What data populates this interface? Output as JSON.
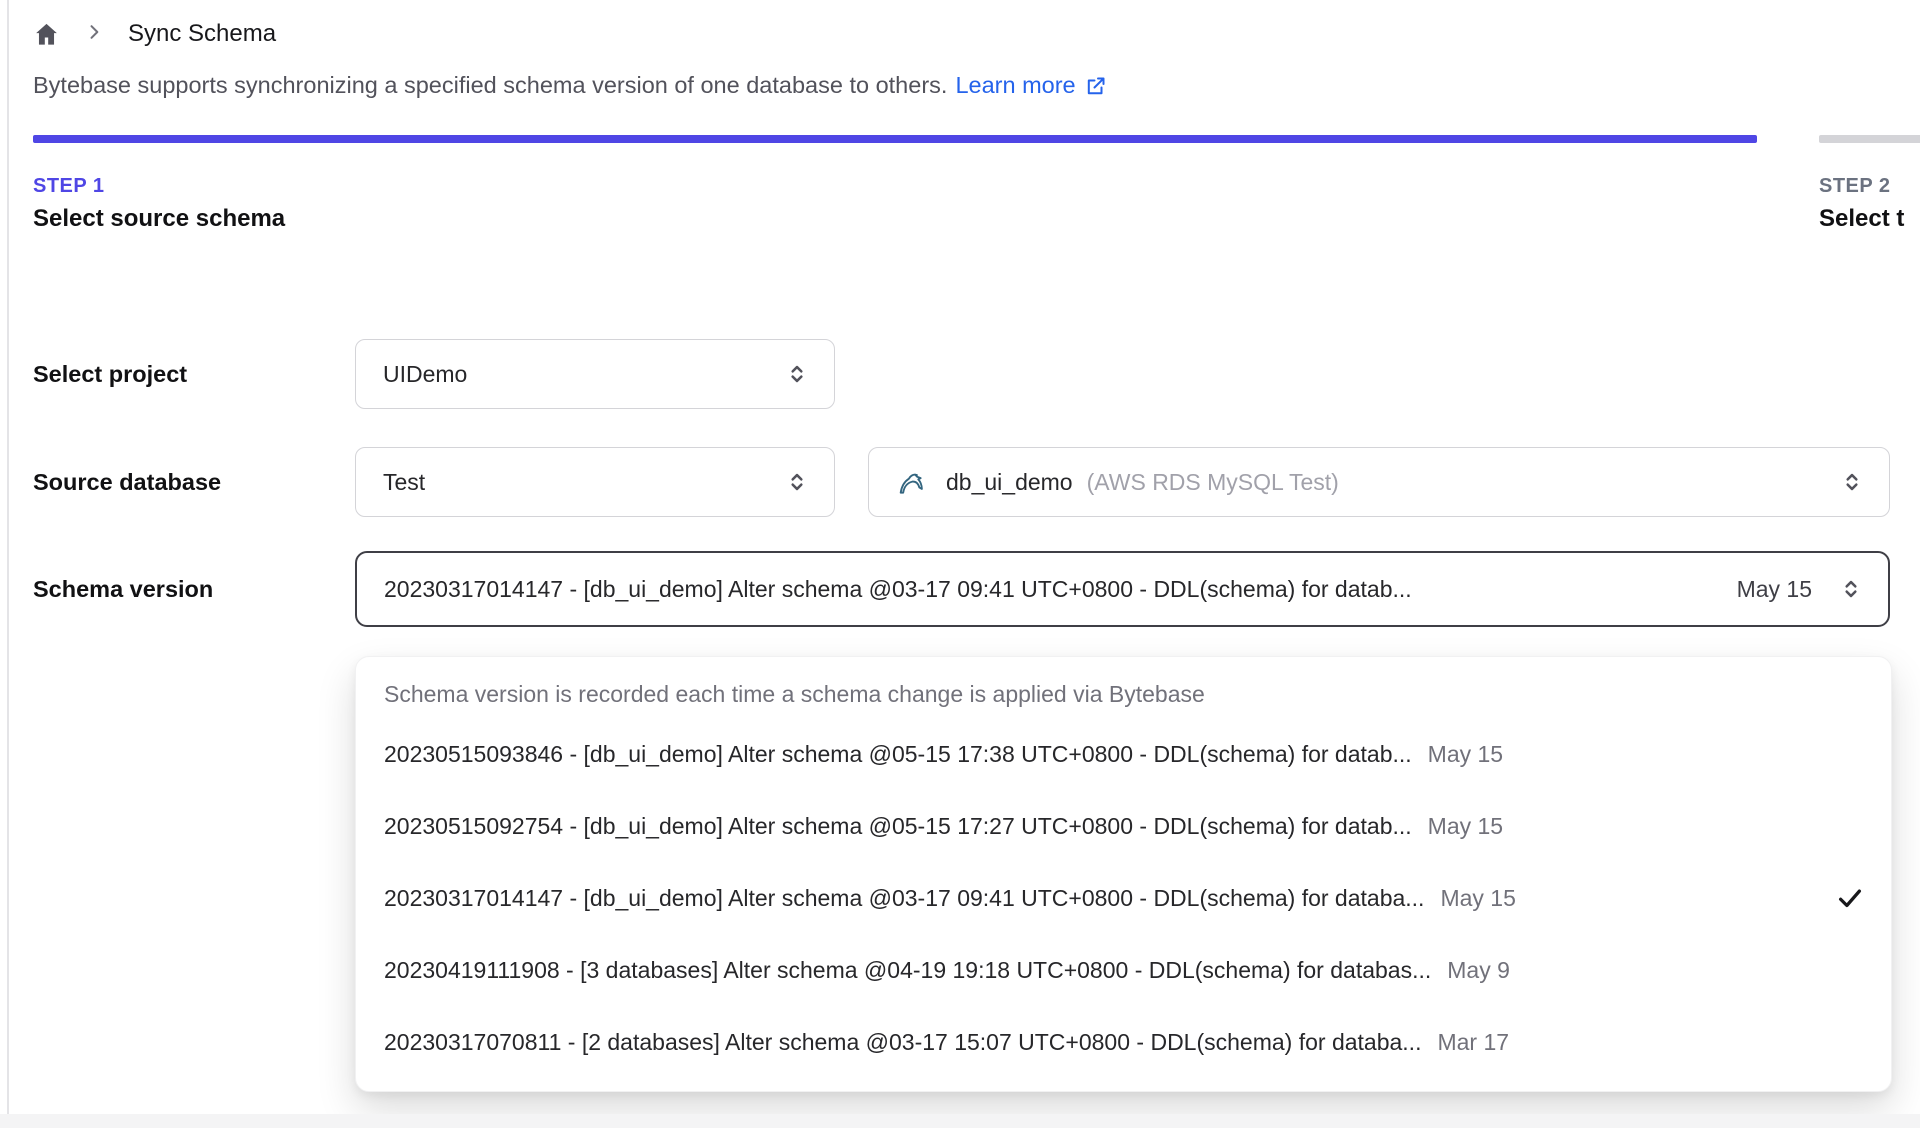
{
  "breadcrumb": {
    "current": "Sync Schema"
  },
  "intro": {
    "text": "Bytebase supports synchronizing a specified schema version of one database to others.",
    "link_label": "Learn more"
  },
  "steps": [
    {
      "label": "STEP 1",
      "title": "Select source schema"
    },
    {
      "label": "STEP 2",
      "title": "Select t"
    }
  ],
  "form": {
    "project": {
      "label": "Select project",
      "value": "UIDemo"
    },
    "source_database": {
      "label": "Source database",
      "env_value": "Test",
      "db_name": "db_ui_demo",
      "db_detail": "(AWS RDS MySQL Test)"
    },
    "schema_version": {
      "label": "Schema version",
      "value": "20230317014147 - [db_ui_demo] Alter schema @03-17 09:41 UTC+0800 - DDL(schema) for datab...",
      "value_date": "May 15"
    }
  },
  "version_dropdown": {
    "hint": "Schema version is recorded each time a schema change is applied via Bytebase",
    "items": [
      {
        "text": "20230515093846 - [db_ui_demo] Alter schema @05-15 17:38 UTC+0800 - DDL(schema) for datab...",
        "date": "May 15",
        "selected": false
      },
      {
        "text": "20230515092754 - [db_ui_demo] Alter schema @05-15 17:27 UTC+0800 - DDL(schema) for datab...",
        "date": "May 15",
        "selected": false
      },
      {
        "text": "20230317014147 - [db_ui_demo] Alter schema @03-17 09:41 UTC+0800 - DDL(schema) for databa...",
        "date": "May 15",
        "selected": true
      },
      {
        "text": "20230419111908 - [3 databases] Alter schema @04-19 19:18 UTC+0800 - DDL(schema) for databas...",
        "date": "May 9",
        "selected": false
      },
      {
        "text": "20230317070811 - [2 databases] Alter schema @03-17 15:07 UTC+0800 - DDL(schema) for databa...",
        "date": "Mar 17",
        "selected": false
      }
    ]
  },
  "colors": {
    "accent_indigo": "#4f46e5",
    "link_blue": "#2563eb",
    "inactive_bar_gray": "#d4d4d8",
    "focus_border": "#3f3f46"
  }
}
